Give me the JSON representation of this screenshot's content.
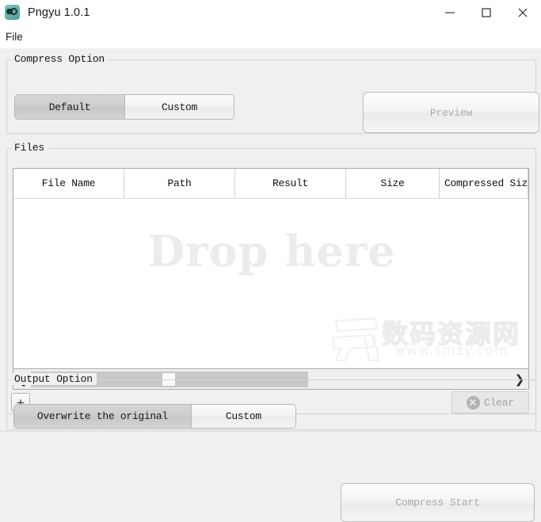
{
  "window": {
    "title": "Pngyu 1.0.1",
    "app_icon": "pngyu-app-icon",
    "controls": {
      "minimize": "minimize-icon",
      "maximize": "maximize-icon",
      "close": "close-icon"
    }
  },
  "menubar": {
    "items": [
      {
        "label": "File"
      }
    ]
  },
  "compress_option": {
    "legend": "Compress Option",
    "modes": [
      {
        "label": "Default",
        "selected": true
      },
      {
        "label": "Custom",
        "selected": false
      }
    ],
    "preview_button": {
      "label": "Preview",
      "enabled": false
    }
  },
  "files": {
    "legend": "Files",
    "columns": [
      {
        "label": "File Name"
      },
      {
        "label": "Path"
      },
      {
        "label": "Result"
      },
      {
        "label": "Size"
      },
      {
        "label": "Compressed Size"
      }
    ],
    "rows": [],
    "drop_hint": "Drop here",
    "scrollbar": {
      "left_arrow": "chevron-left-icon",
      "right_arrow": "chevron-right-icon"
    },
    "add_button": {
      "label": "+"
    },
    "clear_button": {
      "label": "Clear",
      "icon": "cancel-circle-icon",
      "enabled": false
    }
  },
  "output_option": {
    "legend": "Output Option",
    "modes": [
      {
        "label": "Overwrite the original",
        "selected": true
      },
      {
        "label": "Custom",
        "selected": false
      }
    ]
  },
  "compress_start_button": {
    "label": "Compress Start",
    "enabled": false
  },
  "watermark": {
    "text_cn": "数码资源网",
    "url": "www.smzy.com"
  },
  "colors": {
    "window_background": "#f0f0f0",
    "titlebar_background": "#ffffff",
    "table_background": "#ffffff",
    "group_border": "#d2d2d2",
    "selected_segment": "#cdcdcd",
    "drop_hint": "#ececec",
    "disabled_text": "#a9a9a9",
    "app_icon_accent": "#4f9a97"
  }
}
